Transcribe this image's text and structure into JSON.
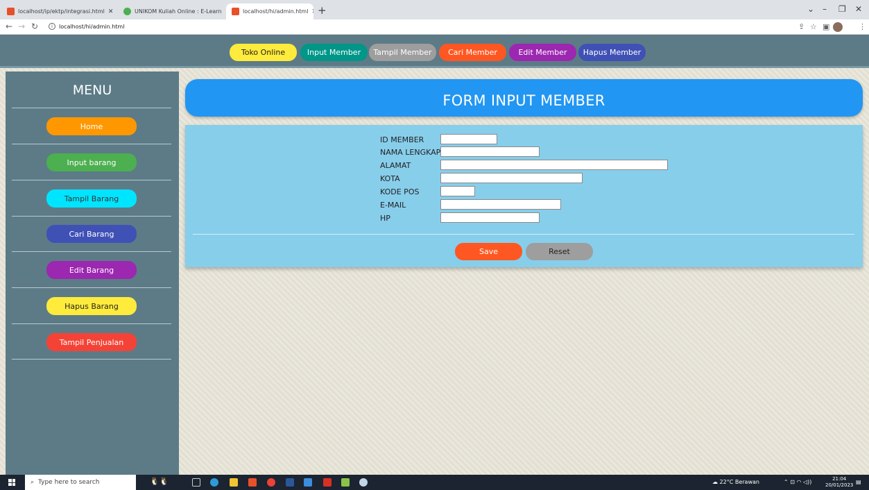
{
  "browser": {
    "tabs": [
      {
        "title": "localhost/ip/ektp/integrasi.html"
      },
      {
        "title": "UNIKOM Kuliah Online : E-Learn"
      },
      {
        "title": "localhost/hi/admin.html"
      }
    ],
    "url": "localhost/hi/admin.html"
  },
  "topnav": {
    "buttons": [
      {
        "label": "Toko Online",
        "color": "#ffeb3b"
      },
      {
        "label": "Input Member",
        "color": "#009688"
      },
      {
        "label": "Tampil Member",
        "color": "#9e9e9e"
      },
      {
        "label": "Cari Member",
        "color": "#ff5722"
      },
      {
        "label": "Edit Member",
        "color": "#9c27b0"
      },
      {
        "label": "Hapus Member",
        "color": "#3f51b5"
      }
    ]
  },
  "sidebar": {
    "title": "MENU",
    "items": [
      {
        "label": "Home",
        "color": "#ff9800"
      },
      {
        "label": "Input barang",
        "color": "#4caf50"
      },
      {
        "label": "Tampil Barang",
        "color": "#00e5ff"
      },
      {
        "label": "Cari Barang",
        "color": "#3f51b5"
      },
      {
        "label": "Edit Barang",
        "color": "#9c27b0"
      },
      {
        "label": "Hapus Barang",
        "color": "#ffeb3b"
      },
      {
        "label": "Tampil Penjualan",
        "color": "#f44336"
      }
    ]
  },
  "form": {
    "title": "FORM INPUT MEMBER",
    "fields": [
      {
        "label": "ID MEMBER",
        "value": ""
      },
      {
        "label": "NAMA LENGKAP",
        "value": ""
      },
      {
        "label": "ALAMAT",
        "value": ""
      },
      {
        "label": "KOTA",
        "value": ""
      },
      {
        "label": "KODE POS",
        "value": ""
      },
      {
        "label": "E-MAIL",
        "value": ""
      },
      {
        "label": "HP",
        "value": ""
      }
    ],
    "save_label": "Save",
    "reset_label": "Reset"
  },
  "taskbar": {
    "search_placeholder": "Type here to search",
    "weather": "22°C  Berawan",
    "time": "21:04",
    "date": "20/01/2023"
  }
}
